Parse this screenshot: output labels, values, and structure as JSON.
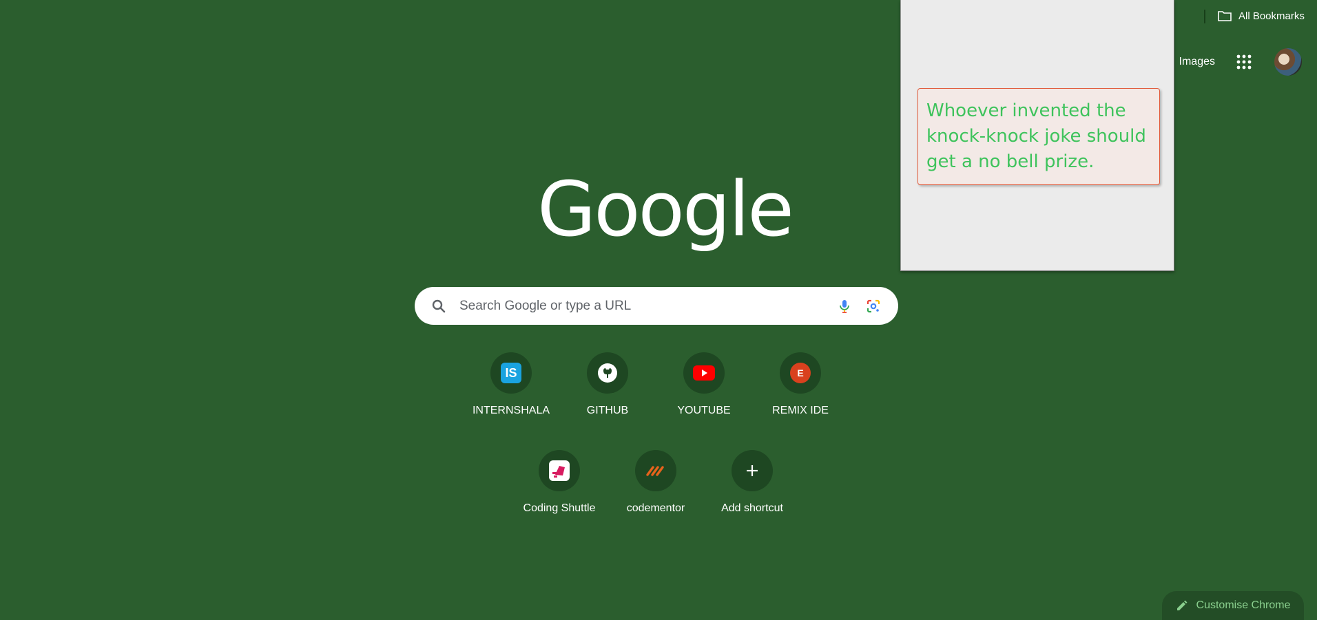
{
  "bookmarks": {
    "all_label": "All Bookmarks"
  },
  "header": {
    "images_label": "Images"
  },
  "popup": {
    "joke_text": "Whoever invented the knock-knock joke should get a no bell prize."
  },
  "logo": {
    "text": "Google"
  },
  "search": {
    "placeholder": "Search Google or type a URL",
    "value": ""
  },
  "shortcuts": [
    {
      "label": "INTERNSHALA",
      "icon": "internshala-icon"
    },
    {
      "label": "GITHUB",
      "icon": "github-icon"
    },
    {
      "label": "YOUTUBE",
      "icon": "youtube-icon"
    },
    {
      "label": "REMIX IDE",
      "icon": "remix-ide-icon"
    },
    {
      "label": "Coding Shuttle",
      "icon": "coding-shuttle-icon"
    },
    {
      "label": "codementor",
      "icon": "codementor-icon"
    },
    {
      "label": "Add shortcut",
      "icon": "plus-icon"
    }
  ],
  "footer": {
    "customise_label": "Customise Chrome"
  },
  "colors": {
    "background": "#2b5e2e",
    "joke_text": "#3ec35c",
    "joke_border": "#e05a3a"
  }
}
